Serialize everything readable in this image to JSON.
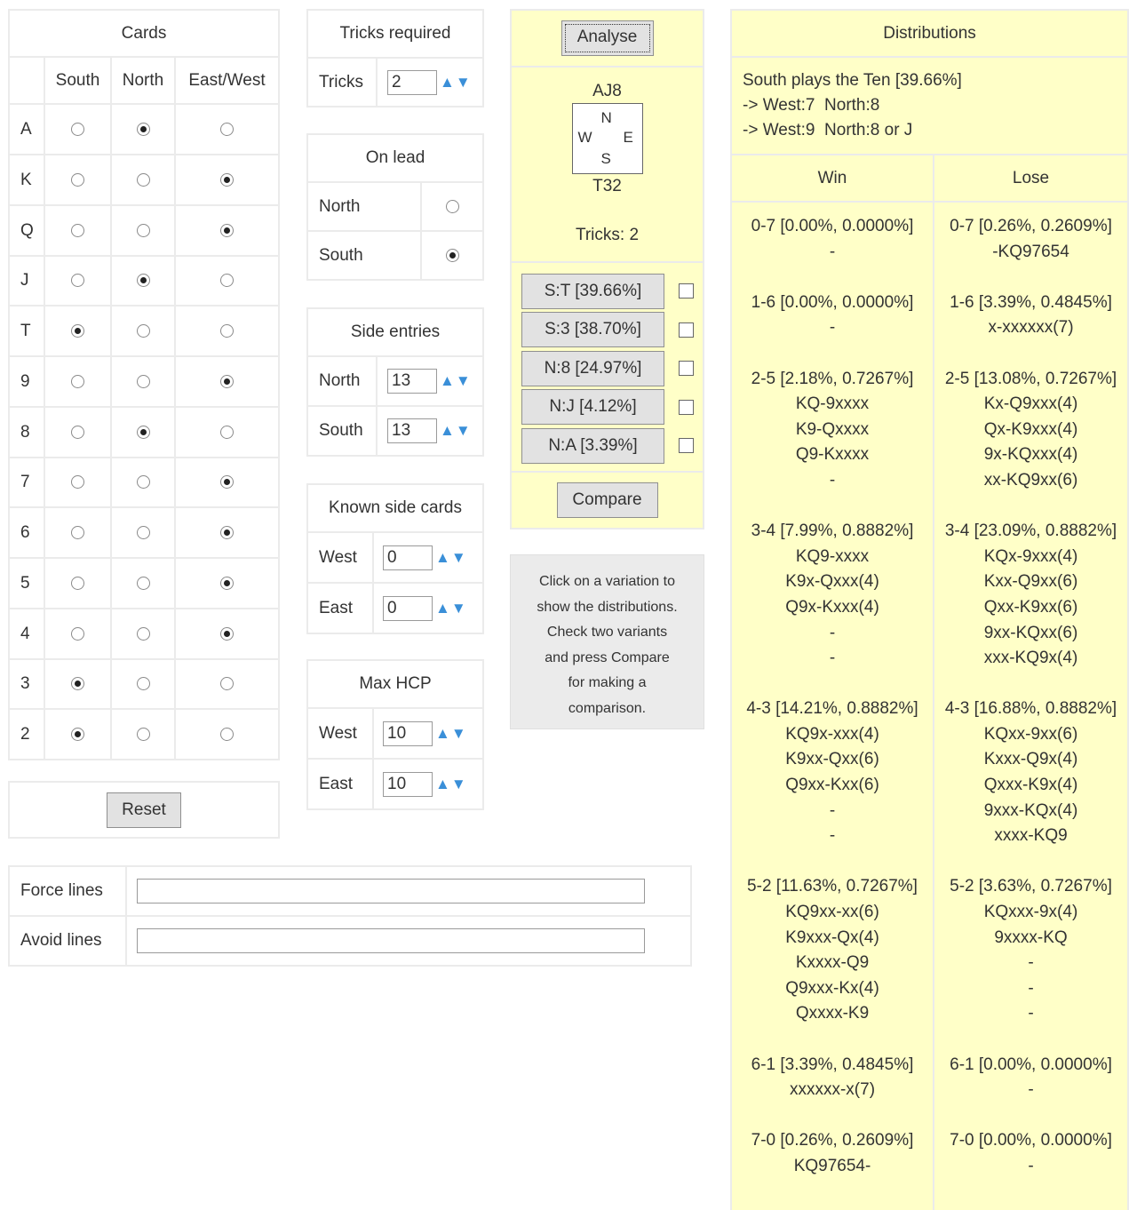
{
  "cards": {
    "title": "Cards",
    "columns": [
      "South",
      "North",
      "East/West"
    ],
    "rows": [
      {
        "rank": "A",
        "selected": 1
      },
      {
        "rank": "K",
        "selected": 2
      },
      {
        "rank": "Q",
        "selected": 2
      },
      {
        "rank": "J",
        "selected": 1
      },
      {
        "rank": "T",
        "selected": 0
      },
      {
        "rank": "9",
        "selected": 2
      },
      {
        "rank": "8",
        "selected": 1
      },
      {
        "rank": "7",
        "selected": 2
      },
      {
        "rank": "6",
        "selected": 2
      },
      {
        "rank": "5",
        "selected": 2
      },
      {
        "rank": "4",
        "selected": 2
      },
      {
        "rank": "3",
        "selected": 0
      },
      {
        "rank": "2",
        "selected": 0
      }
    ],
    "reset_label": "Reset"
  },
  "tricks": {
    "title": "Tricks required",
    "label": "Tricks",
    "value": "2"
  },
  "on_lead": {
    "title": "On lead",
    "north": "North",
    "south": "South",
    "selected": "South"
  },
  "side_entries": {
    "title": "Side entries",
    "north_label": "North",
    "north_value": "13",
    "south_label": "South",
    "south_value": "13"
  },
  "known_side": {
    "title": "Known side cards",
    "west_label": "West",
    "west_value": "0",
    "east_label": "East",
    "east_value": "0"
  },
  "max_hcp": {
    "title": "Max HCP",
    "west_label": "West",
    "west_value": "10",
    "east_label": "East",
    "east_value": "10"
  },
  "lines": {
    "force_label": "Force lines",
    "force_value": "",
    "avoid_label": "Avoid lines",
    "avoid_value": ""
  },
  "analysis": {
    "analyse_label": "Analyse",
    "north_hand": "AJ8",
    "south_hand": "T32",
    "compass": {
      "n": "N",
      "w": "W",
      "e": "E",
      "s": "S"
    },
    "tricks_text": "Tricks: 2",
    "variations": [
      "S:T [39.66%]",
      "S:3 [38.70%]",
      "N:8 [24.97%]",
      "N:J [4.12%]",
      "N:A [3.39%]"
    ],
    "compare_label": "Compare",
    "help_lines": [
      "Click on a variation to",
      "show the distributions.",
      "Check two variants",
      "and press Compare",
      "for making a",
      "comparison."
    ]
  },
  "distributions": {
    "title": "Distributions",
    "summary": [
      "South plays the Ten [39.66%]",
      "-> West:7  North:8",
      "-> West:9  North:8 or J"
    ],
    "win_header": "Win",
    "lose_header": "Lose",
    "groups": [
      {
        "win": [
          "0-7 [0.00%, 0.0000%]",
          "-"
        ],
        "lose": [
          "0-7 [0.26%, 0.2609%]",
          "-KQ97654"
        ]
      },
      {
        "win": [
          "1-6 [0.00%, 0.0000%]",
          "-"
        ],
        "lose": [
          "1-6 [3.39%, 0.4845%]",
          "x-xxxxxx(7)"
        ]
      },
      {
        "win": [
          "2-5 [2.18%, 0.7267%]",
          "KQ-9xxxx",
          "K9-Qxxxx",
          "Q9-Kxxxx",
          "-"
        ],
        "lose": [
          "2-5 [13.08%, 0.7267%]",
          "Kx-Q9xxx(4)",
          "Qx-K9xxx(4)",
          "9x-KQxxx(4)",
          "xx-KQ9xx(6)"
        ]
      },
      {
        "win": [
          "3-4 [7.99%, 0.8882%]",
          "KQ9-xxxx",
          "K9x-Qxxx(4)",
          "Q9x-Kxxx(4)",
          "-",
          "-"
        ],
        "lose": [
          "3-4 [23.09%, 0.8882%]",
          "KQx-9xxx(4)",
          "Kxx-Q9xx(6)",
          "Qxx-K9xx(6)",
          "9xx-KQxx(6)",
          "xxx-KQ9x(4)"
        ]
      },
      {
        "win": [
          "4-3 [14.21%, 0.8882%]",
          "KQ9x-xxx(4)",
          "K9xx-Qxx(6)",
          "Q9xx-Kxx(6)",
          "-",
          "-"
        ],
        "lose": [
          "4-3 [16.88%, 0.8882%]",
          "KQxx-9xx(6)",
          "Kxxx-Q9x(4)",
          "Qxxx-K9x(4)",
          "9xxx-KQx(4)",
          "xxxx-KQ9"
        ]
      },
      {
        "win": [
          "5-2 [11.63%, 0.7267%]",
          "KQ9xx-xx(6)",
          "K9xxx-Qx(4)",
          "Kxxxx-Q9",
          "Q9xxx-Kx(4)",
          "Qxxxx-K9"
        ],
        "lose": [
          "5-2 [3.63%, 0.7267%]",
          "KQxxx-9x(4)",
          "9xxxx-KQ",
          "-",
          "-",
          "-"
        ]
      },
      {
        "win": [
          "6-1 [3.39%, 0.4845%]",
          "xxxxxx-x(7)"
        ],
        "lose": [
          "6-1 [0.00%, 0.0000%]",
          "-"
        ]
      },
      {
        "win": [
          "7-0 [0.26%, 0.2609%]",
          "KQ97654-"
        ],
        "lose": [
          "7-0 [0.00%, 0.0000%]",
          "-"
        ]
      }
    ]
  }
}
